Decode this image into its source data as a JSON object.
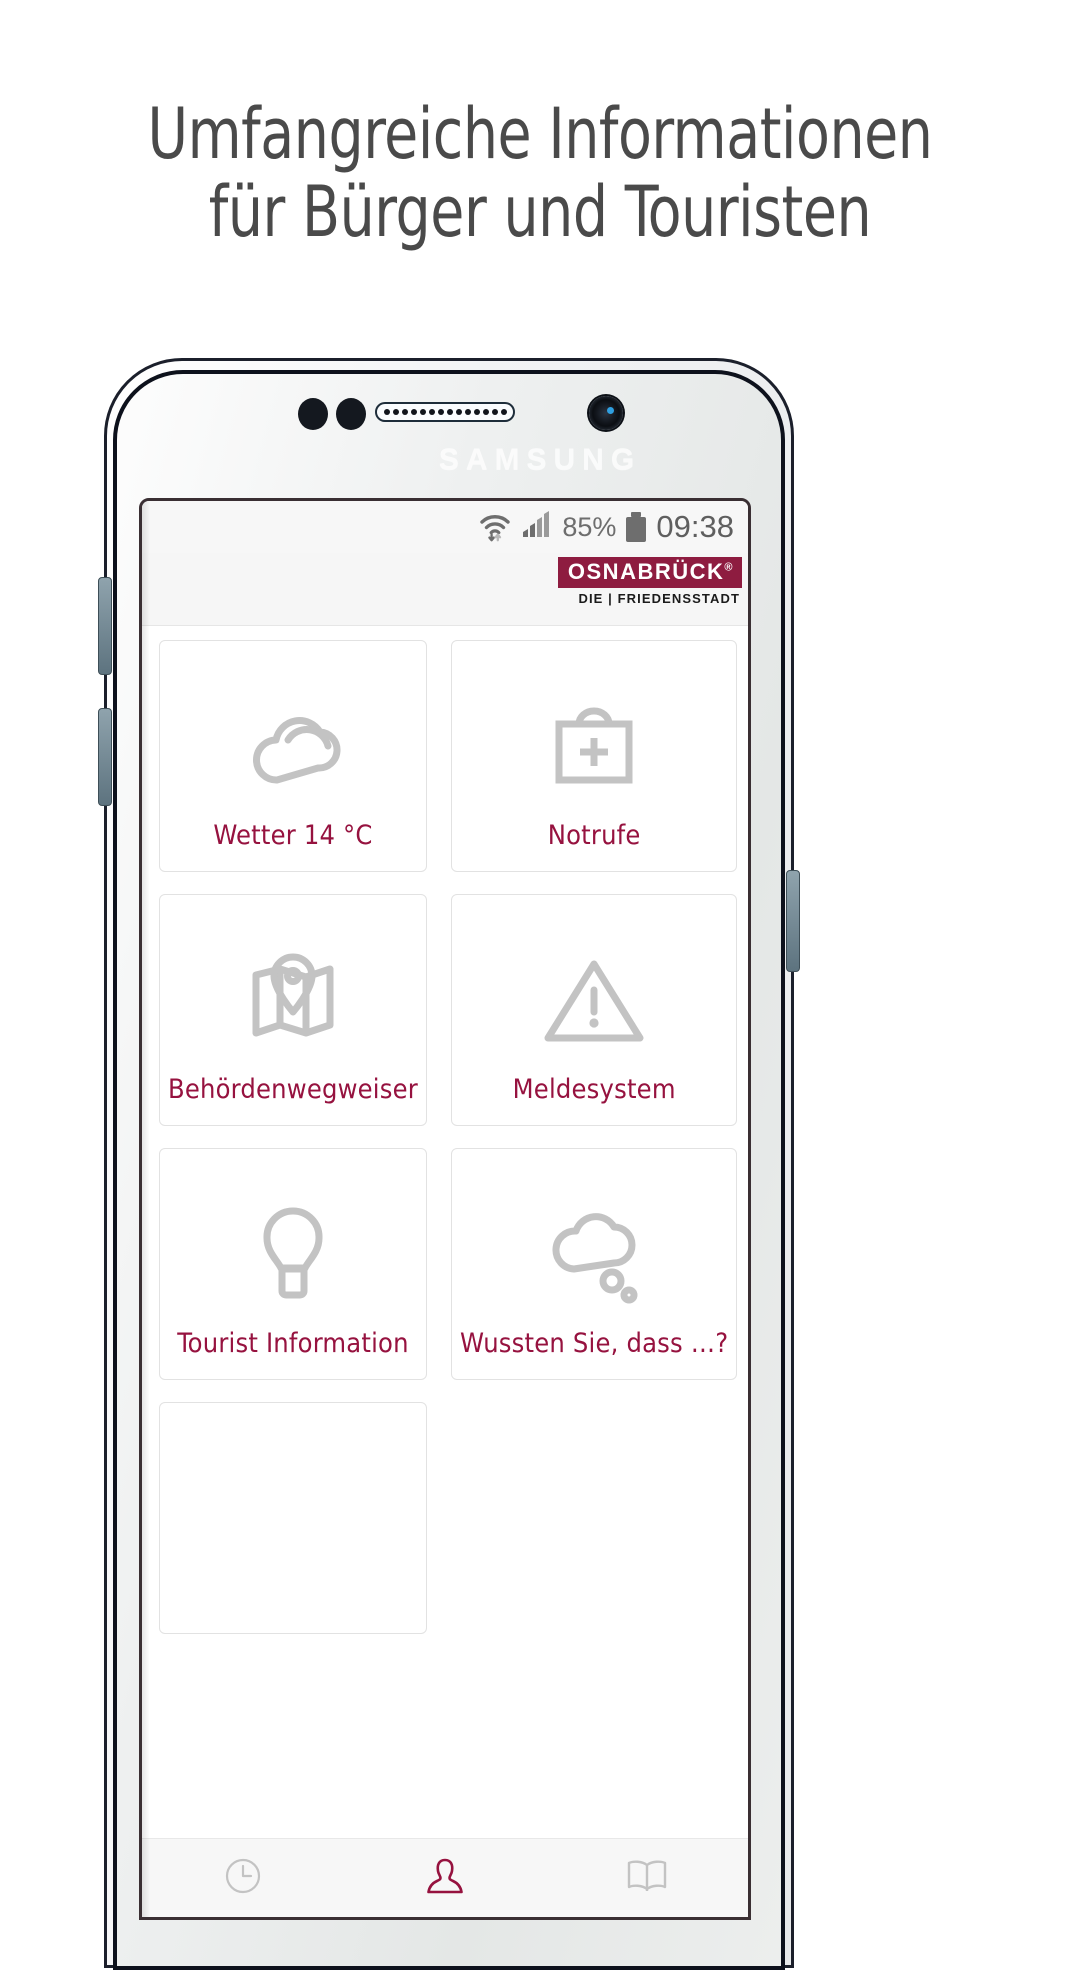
{
  "headline": {
    "line1": "Umfangreiche Informationen",
    "line2": "für Bürger und Touristen",
    "color": "#4a4a4a"
  },
  "device": {
    "brand": "SAMSUNG",
    "frame_color": "#0d111c"
  },
  "statusbar": {
    "wifi_icon": "wifi-icon",
    "signal_icon": "signal-bars-icon",
    "battery_percent": "85%",
    "battery_icon": "battery-icon",
    "time": "09:38",
    "text_color": "#6e6e6e"
  },
  "app_header": {
    "logo_text": "OSNABRÜCK",
    "logo_registered": "®",
    "logo_subtitle": "DIE | FRIEDENSSTADT",
    "logo_bg": "#8e1c40",
    "logo_fg": "#ffffff"
  },
  "tiles": {
    "accent_color": "#96123f",
    "icon_color": "#c3c3c3",
    "items": [
      {
        "label": "Wetter 14 °C",
        "icon": "cloud-icon"
      },
      {
        "label": "Notrufe",
        "icon": "first-aid-kit-icon"
      },
      {
        "label": "Behördenwegweiser",
        "icon": "map-pin-icon"
      },
      {
        "label": "Meldesystem",
        "icon": "warning-triangle-icon"
      },
      {
        "label": "Tourist Information",
        "icon": "lightbulb-icon"
      },
      {
        "label": "Wussten Sie, dass …?",
        "icon": "thought-bubble-icon"
      },
      {
        "label": "",
        "icon": ""
      }
    ]
  },
  "navbar": {
    "items": [
      {
        "icon": "clock-icon",
        "active": false
      },
      {
        "icon": "person-icon",
        "active": true
      },
      {
        "icon": "book-icon",
        "active": false
      }
    ],
    "active_color": "#96123f",
    "inactive_color": "#c3c3c3"
  }
}
